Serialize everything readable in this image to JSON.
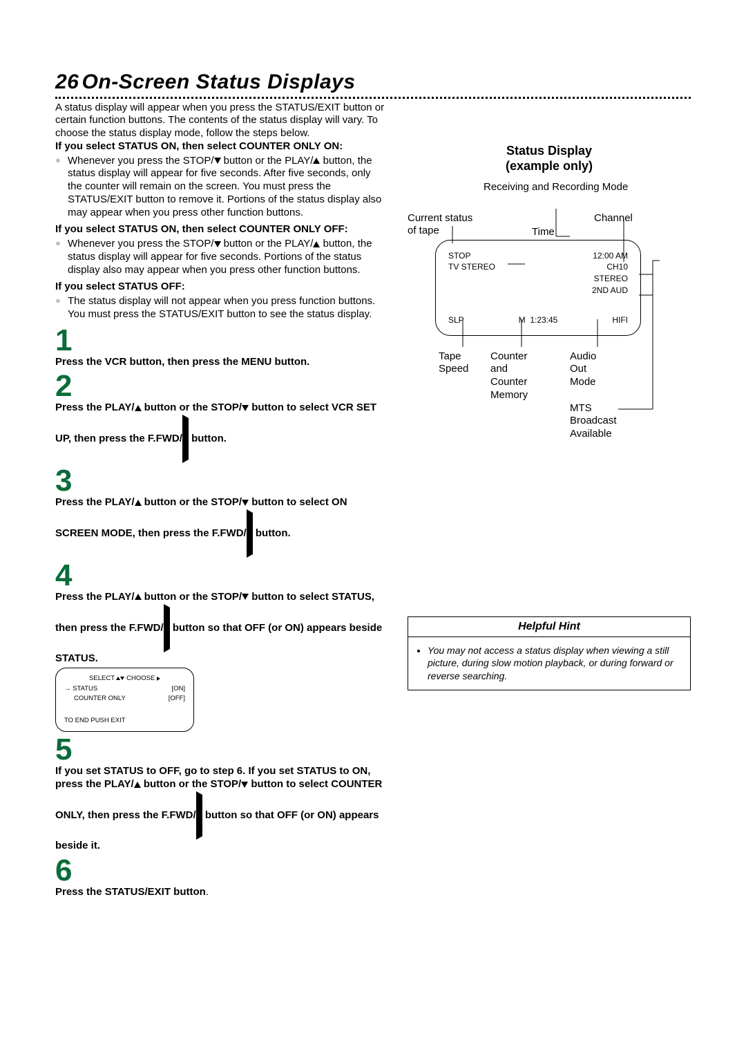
{
  "title_num": "26",
  "title_text": "On-Screen Status Displays",
  "intro": "A status display will appear when you press the STATUS/EXIT button or certain function buttons. The contents of the status display will vary. To choose the status display mode, follow the steps below.",
  "opt1_header": "If you select STATUS ON, then select COUNTER ONLY ON:",
  "opt1_pre": "Whenever you press the STOP/",
  "opt1_mid": " button or the PLAY/",
  "opt1_post": " button, the status display will appear for five seconds. After five seconds, only the counter will remain on the screen. You must press the STATUS/EXIT button to remove it. Portions of the status display also may appear when you press other function buttons.",
  "opt2_header": "If you select STATUS ON, then select COUNTER ONLY OFF:",
  "opt2_pre": "Whenever you press the STOP/",
  "opt2_mid": " button or the PLAY/",
  "opt2_post": " button, the status display will appear for five seconds. Portions of the status display also may appear when you press other function buttons.",
  "opt3_header": "If you select STATUS OFF:",
  "opt3_text": "The status display will not appear when you press function buttons. You must press the STATUS/EXIT button to see the status display.",
  "step1_num": "1",
  "step1": "Press the VCR button, then press the MENU button.",
  "step2_num": "2",
  "step2_a": "Press the PLAY/",
  "step2_b": " button or the STOP/",
  "step2_c": " button to select VCR SET UP, then press the F.FWD/",
  "step2_d": " button.",
  "step3_num": "3",
  "step3_a": "Press the PLAY/",
  "step3_b": " button or the STOP/",
  "step3_c": " button to select ON SCREEN MODE, then press the F.FWD/",
  "step3_d": " button.",
  "step4_num": "4",
  "step4_a": "Press the PLAY/",
  "step4_b": " button or the STOP/",
  "step4_c": " button to select STATUS, then press the F.FWD/",
  "step4_d": " button so that OFF (or ON) appears beside STATUS.",
  "osd": {
    "select": "SELECT",
    "choose": "CHOOSE",
    "status": "STATUS",
    "status_val": "[ON]",
    "counter": "COUNTER ONLY",
    "counter_val": "[OFF]",
    "end": "TO END PUSH EXIT"
  },
  "step5_num": "5",
  "step5_a": "If you set STATUS to OFF, go to step 6. If you set STATUS to ON, press the PLAY/",
  "step5_b": " button or the STOP/",
  "step5_c": " button to select COUNTER ONLY, then press the F.FWD/",
  "step5_d": " button so that OFF (or ON) appears beside it.",
  "step6_num": "6",
  "step6_a": "Press the STATUS/EXIT button",
  "step6_b": ".",
  "right_header1": "Status Display",
  "right_header2": "(example only)",
  "diagram": {
    "receiving": "Receiving and Recording Mode",
    "current": "Current status of tape",
    "channel": "Channel",
    "time": "Time",
    "stop": "STOP",
    "tvstereo": "TV STEREO",
    "clock": "12:00 AM",
    "ch": "CH10",
    "stereo": "STEREO",
    "aud2": "2ND AUD",
    "slp": "SLP",
    "m": "M",
    "counter_val": "1:23:45",
    "hifi": "HIFI",
    "tapespeed": "Tape Speed",
    "counter": "Counter and Counter Memory",
    "audio": "Audio Out Mode",
    "mts": "MTS Broadcast Available"
  },
  "hint_title": "Helpful Hint",
  "hint_body": "You may not access a status display when viewing a still picture, during slow motion playback, or during forward or reverse searching."
}
